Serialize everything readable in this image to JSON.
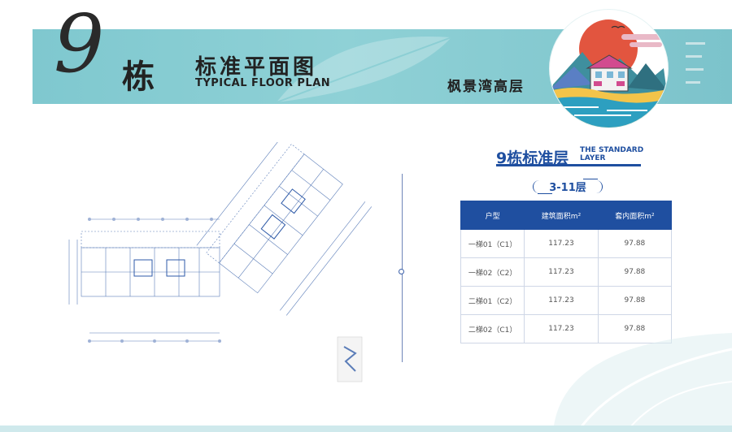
{
  "header": {
    "building_number": "9",
    "building_suffix": "栋",
    "title_cn": "标准平面图",
    "title_en": "TYPICAL FLOOR PLAN",
    "estate_name": "枫景湾高层"
  },
  "floor": {
    "title_cn": "9栋标准层",
    "title_en": "THE STANDARD LAYER",
    "levels": "3-11层"
  },
  "table": {
    "headers": [
      "户型",
      "建筑面积m²",
      "套内面积m²"
    ],
    "rows": [
      [
        "一梯01（C1）",
        "117.23",
        "97.88"
      ],
      [
        "一梯02（C2）",
        "117.23",
        "97.88"
      ],
      [
        "二梯01（C2）",
        "117.23",
        "97.88"
      ],
      [
        "二梯02（C1）",
        "117.23",
        "97.88"
      ]
    ]
  },
  "colors": {
    "banner": "#8fd1d6",
    "accent_blue": "#1f4fa0",
    "sun_red": "#e2553f"
  }
}
